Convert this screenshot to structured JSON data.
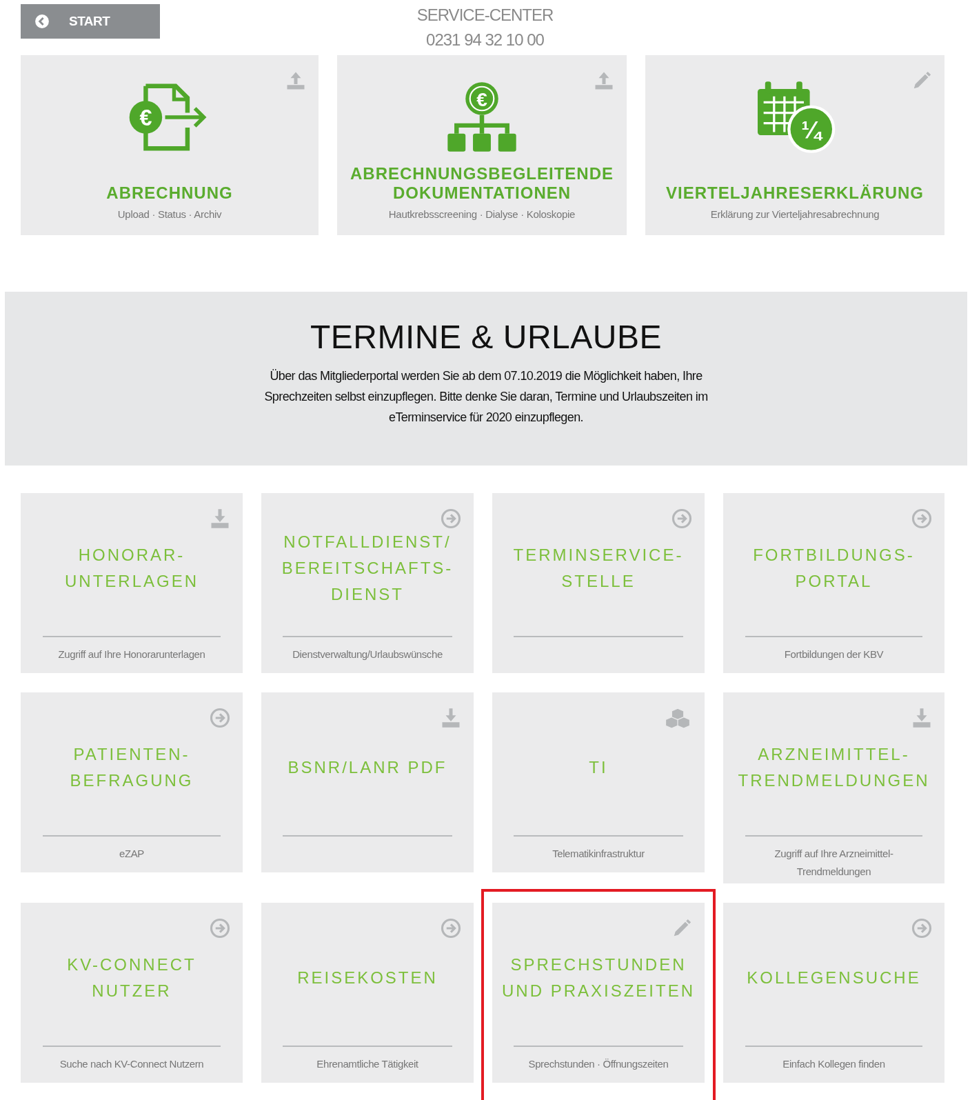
{
  "start_button": {
    "label": "START"
  },
  "service_center": {
    "title": "SERVICE-CENTER",
    "phone": "0231 94 32 10 00"
  },
  "feature_tiles": [
    {
      "kind": "upload",
      "illustration": {
        "kind": "invoice",
        "symbol": "€"
      },
      "title": "ABRECHNUNG",
      "subtitle": "Upload · Status · Archiv"
    },
    {
      "kind": "upload",
      "illustration": {
        "kind": "hierarchy",
        "symbol": "€"
      },
      "title": "ABRECHNUNGSBEGLEITENDE DOKUMENTATIONEN",
      "subtitle": "Hautkrebsscreening · Dialyse · Koloskopie"
    },
    {
      "kind": "edit",
      "illustration": {
        "kind": "calendar",
        "symbol": "¼"
      },
      "title": "VIERTELJAHRESERKLÄRUNG",
      "subtitle": "Erklärung zur Vierteljahresabrechnung"
    }
  ],
  "banner": {
    "title": "TERMINE & URLAUBE",
    "text": "Über das Mitgliederportal werden Sie ab dem 07.10.2019 die Möglichkeit haben, Ihre Sprechzeiten selbst einzupflegen. Bitte denke Sie daran, Termine und Urlaubszeiten im eTerminservice für 2020 einzupflegen."
  },
  "tiles": [
    {
      "kind": "download",
      "title": "HONORAR-\nUNTERLAGEN",
      "subtitle": "Zugriff auf Ihre Honorarunterlagen",
      "highlighted": false
    },
    {
      "kind": "link",
      "title": "NOTFALLDIENST/\nBEREITSCHAFTS-\nDIENST",
      "subtitle": "Dienstverwaltung/Urlaubswünsche",
      "highlighted": false
    },
    {
      "kind": "link",
      "title": "TERMINSERVICE-\nSTELLE",
      "highlighted": false
    },
    {
      "kind": "link",
      "title": "FORTBILDUNGS-\nPORTAL",
      "subtitle": "Fortbildungen der KBV",
      "highlighted": false
    },
    {
      "kind": "link",
      "title": "PATIENTEN-\nBEFRAGUNG",
      "subtitle": "eZAP",
      "highlighted": false
    },
    {
      "kind": "download",
      "title": "BSNR/LANR PDF",
      "highlighted": false
    },
    {
      "kind": "modules",
      "title": "TI",
      "subtitle": "Telematikinfrastruktur",
      "highlighted": false
    },
    {
      "kind": "download",
      "title": "ARZNEIMITTEL-\nTRENDMELDUNGEN",
      "subtitle": "Zugriff auf Ihre Arzneimittel-\nTrendmeldungen",
      "highlighted": false
    },
    {
      "kind": "link",
      "title": "KV-CONNECT\nNUTZER",
      "subtitle": "Suche nach KV-Connect Nutzern",
      "highlighted": false
    },
    {
      "kind": "link",
      "title": "REISEKOSTEN",
      "subtitle": "Ehrenamtliche Tätigkeit",
      "highlighted": false
    },
    {
      "kind": "edit",
      "title": "SPRECHSTUNDEN\nUND PRAXISZEITEN",
      "subtitle": "Sprechstunden · Öffnungszeiten",
      "highlighted": true
    },
    {
      "kind": "link",
      "title": "KOLLEGENSUCHE",
      "subtitle": "Einfach Kollegen finden",
      "highlighted": false
    }
  ]
}
